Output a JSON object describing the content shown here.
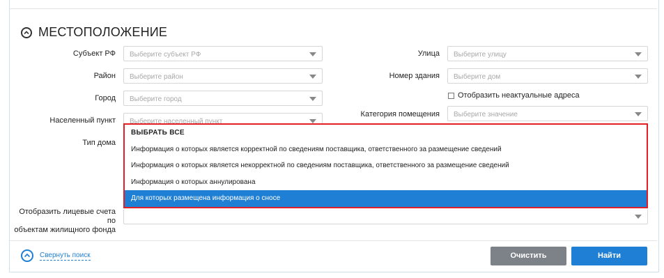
{
  "section": {
    "title": "МЕСТОПОЛОЖЕНИЕ",
    "icon": "chevron-up-circle-icon"
  },
  "fields": {
    "subject": {
      "label": "Субъект РФ",
      "placeholder": "Выберите субъект РФ"
    },
    "district": {
      "label": "Район",
      "placeholder": "Выберите район"
    },
    "city": {
      "label": "Город",
      "placeholder": "Выберите город"
    },
    "settlement": {
      "label": "Населенный пункт",
      "placeholder": "Выберите населенный пункт"
    },
    "house_type": {
      "label": "Тип дома"
    },
    "street": {
      "label": "Улица",
      "placeholder": "Выберите улицу"
    },
    "building": {
      "label": "Номер здания",
      "placeholder": "Выберите дом"
    },
    "show_irrelevant": {
      "label": "Отобразить неактуальные адреса",
      "checked": false
    },
    "room_category": {
      "label": "Категория помещения",
      "placeholder": "Выберите значение"
    },
    "show_accounts": {
      "label_line1": "Отобразить лицевые счета по",
      "label_line2": "объектам жилищного фонда"
    }
  },
  "dropdown": {
    "items": [
      {
        "label": "ВЫБРАТЬ ВСЕ"
      },
      {
        "label": "Информация о которых является корректной по сведениям поставщика, ответственного за размещение сведений"
      },
      {
        "label": "Информация о которых является некорректной по сведениям поставщика, ответственного за размещение сведений"
      },
      {
        "label": "Информация о которых аннулирована"
      },
      {
        "label": "Для которых размещена информация о сносе"
      }
    ],
    "selected_index": 4
  },
  "footer": {
    "collapse_label": "Свернуть поиск",
    "clear_label": "Очистить",
    "find_label": "Найти"
  },
  "colors": {
    "accent": "#1f7fd4",
    "highlight_border": "#e31e24",
    "clear_button": "#7c8287"
  }
}
